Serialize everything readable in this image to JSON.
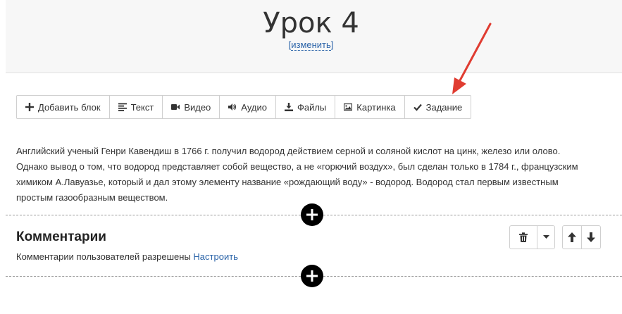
{
  "header": {
    "title": "Урок 4",
    "edit_link": "изменить",
    "bracket_open": "[",
    "bracket_close": "]"
  },
  "toolbar": {
    "items": [
      {
        "label": "Добавить блок",
        "icon": "plus-icon"
      },
      {
        "label": "Текст",
        "icon": "text-align-icon"
      },
      {
        "label": "Видео",
        "icon": "video-camera-icon"
      },
      {
        "label": "Аудио",
        "icon": "volume-icon"
      },
      {
        "label": "Файлы",
        "icon": "download-icon"
      },
      {
        "label": "Картинка",
        "icon": "image-icon"
      },
      {
        "label": "Задание",
        "icon": "check-icon"
      }
    ]
  },
  "content": {
    "lines": [
      "Английский ученый Генри Кавендиш в 1766 г. получил водород действием серной и соляной кислот на цинк, железо или олово.",
      "Однако вывод о том, что водород представляет собой вещество, а не «горючий воздух», был сделан только в 1784 г., французским",
      "химиком А.Лавуазье, который и дал этому элементу название «рождающий воду» - водород. Водород стал первым известным",
      "простым газообразным веществом."
    ]
  },
  "comments": {
    "title": "Комментарии",
    "status_text": "Комментарии пользователей разрешены",
    "settings_link": "Настроить"
  },
  "colors": {
    "link": "#2a63a8",
    "annotation_arrow": "#e03c31"
  }
}
